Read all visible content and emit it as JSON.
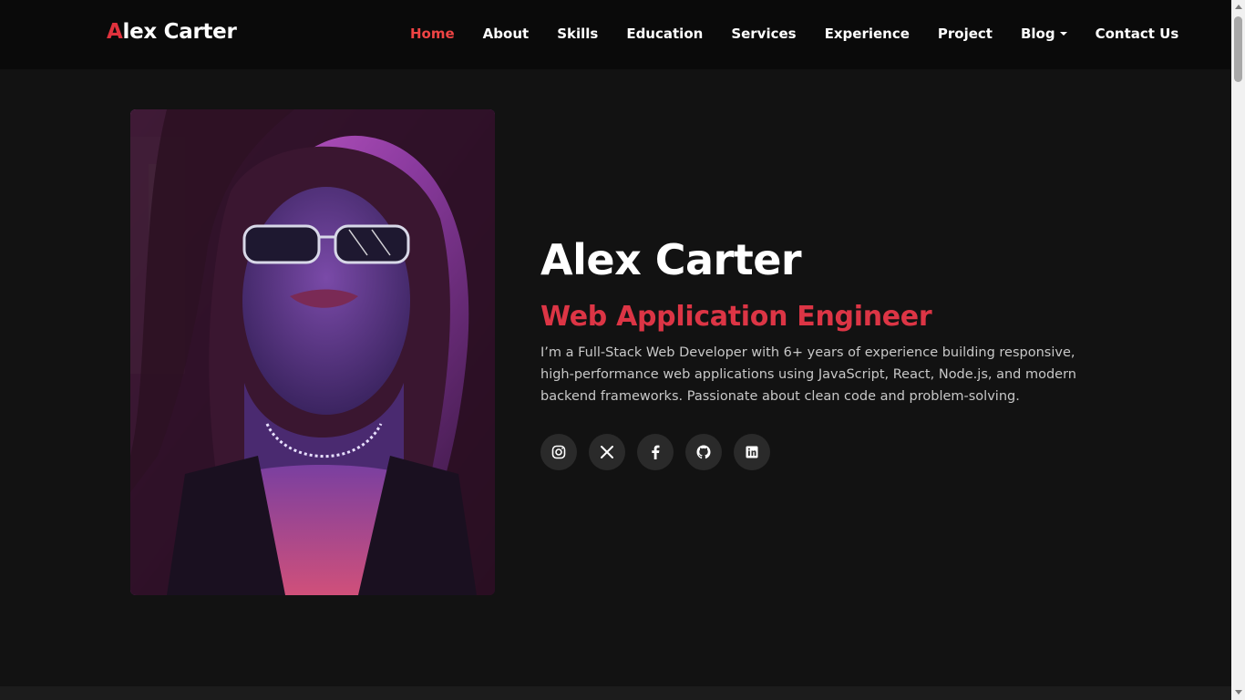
{
  "brand": {
    "first_letter": "A",
    "rest": "lex Carter"
  },
  "nav": {
    "items": [
      {
        "label": "Home",
        "active": true
      },
      {
        "label": "About"
      },
      {
        "label": "Skills"
      },
      {
        "label": "Education"
      },
      {
        "label": "Services"
      },
      {
        "label": "Experience"
      },
      {
        "label": "Project"
      },
      {
        "label": "Blog",
        "dropdown": true
      },
      {
        "label": "Contact Us"
      }
    ]
  },
  "hero": {
    "name": "Alex Carter",
    "role": "Web Application Engineer",
    "bio": "I’m a Full-Stack Web Developer with 6+ years of experience building responsive, high-performance web applications using JavaScript, React, Node.js, and modern backend frameworks. Passionate about clean code and problem-solving.",
    "photo_icon": "portrait-photo"
  },
  "socials": [
    {
      "icon": "instagram-icon"
    },
    {
      "icon": "x-twitter-icon"
    },
    {
      "icon": "facebook-icon"
    },
    {
      "icon": "github-icon"
    },
    {
      "icon": "linkedin-icon"
    }
  ],
  "colors": {
    "accent": "#dc3545",
    "active_nav": "#ef4444",
    "background": "#121212",
    "navbar": "#0a0a0a",
    "social_bg": "#2a2a2a"
  }
}
